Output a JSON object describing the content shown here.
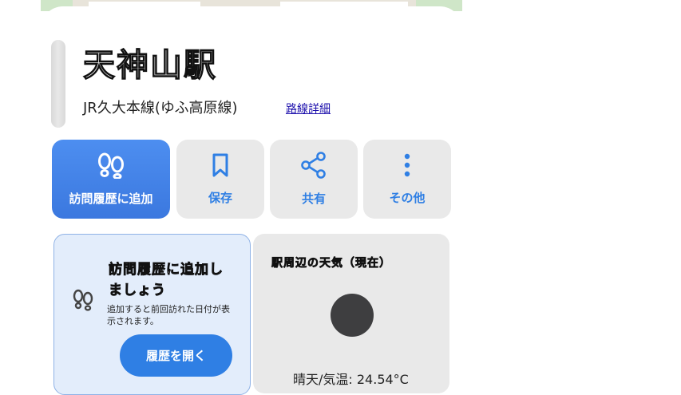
{
  "station": {
    "name": "天神山駅",
    "line": "JR久大本線(ゆふ高原線)",
    "line_detail_link": "路線詳細"
  },
  "actions": {
    "visit": "訪問履歴に追加",
    "save": "保存",
    "share": "共有",
    "more": "その他"
  },
  "visit_card": {
    "title": "訪問履歴に追加しましょう",
    "description": "追加すると前回訪れた日付が表示されます。",
    "button": "履歴を開く"
  },
  "weather_card": {
    "title": "駅周辺の天気（現在）",
    "condition_text": "晴天/気温: 24.54°C"
  },
  "colors": {
    "primary": "#3b78df",
    "accent_text": "#2f7fe4"
  },
  "icons": {
    "visit": "footsteps-icon",
    "save": "bookmark-icon",
    "share": "share-icon",
    "more": "more-vertical-icon",
    "weather": "weather-icon"
  }
}
